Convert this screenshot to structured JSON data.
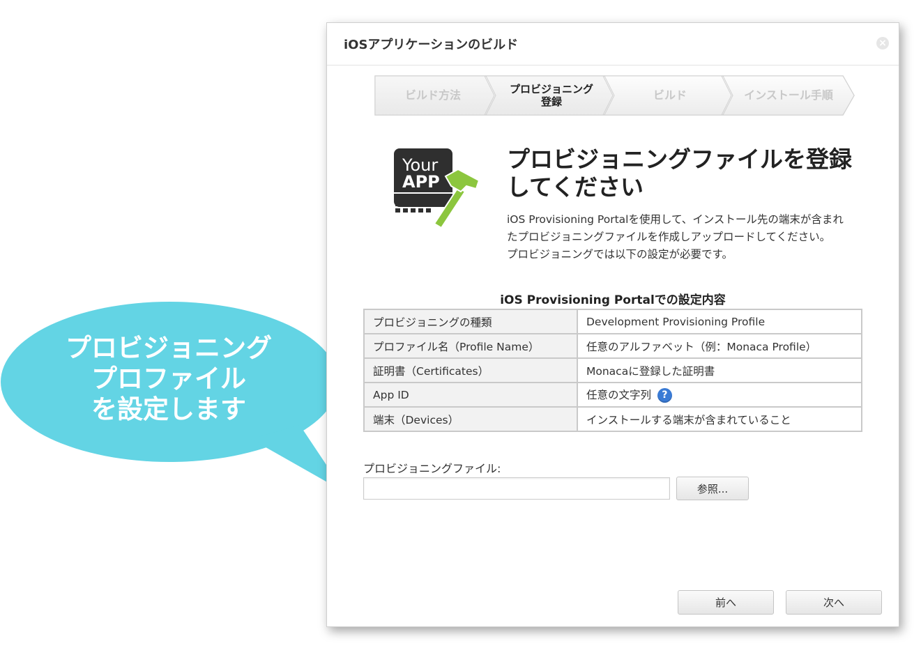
{
  "callout": {
    "line1": "プロビジョニング",
    "line2": "プロファイル",
    "line3": "を設定します",
    "color": "#63d4e4"
  },
  "dialog": {
    "title": "iOSアプリケーションのビルド",
    "close_icon": "close-icon"
  },
  "steps": [
    {
      "label": "ビルド方法",
      "active": false
    },
    {
      "label_line1": "プロビジョニング",
      "label_line2": "登録",
      "active": true
    },
    {
      "label": "ビルド",
      "active": false
    },
    {
      "label": "インストール手順",
      "active": false
    }
  ],
  "hero": {
    "icon_text_line1": "Your",
    "icon_text_line2": "APP",
    "title_line1": "プロビジョニングファイルを登録",
    "title_line2": "してください",
    "desc_line1": "iOS Provisioning Portalを使用して、インストール先の端末が含まれ",
    "desc_line2": "たプロビジョニングファイルを作成しアップロードしてください。",
    "desc_line3": "プロビジョニングでは以下の設定が必要です。"
  },
  "settings": {
    "caption": "iOS Provisioning Portalでの設定内容",
    "rows": [
      {
        "label": "プロビジョニングの種類",
        "value": "Development Provisioning Profile"
      },
      {
        "label": "プロファイル名（Profile Name）",
        "value": "任意のアルファベット（例：Monaca Profile）"
      },
      {
        "label": "証明書（Certificates）",
        "value": "Monacaに登録した証明書"
      },
      {
        "label": "App ID",
        "value": "任意の文字列",
        "help_icon": "?"
      },
      {
        "label": "端末（Devices）",
        "value": "インストールする端末が含まれていること"
      }
    ]
  },
  "file": {
    "label": "プロビジョニングファイル:",
    "value": "",
    "browse_label": "参照..."
  },
  "footer": {
    "prev_label": "前へ",
    "next_label": "次へ"
  }
}
